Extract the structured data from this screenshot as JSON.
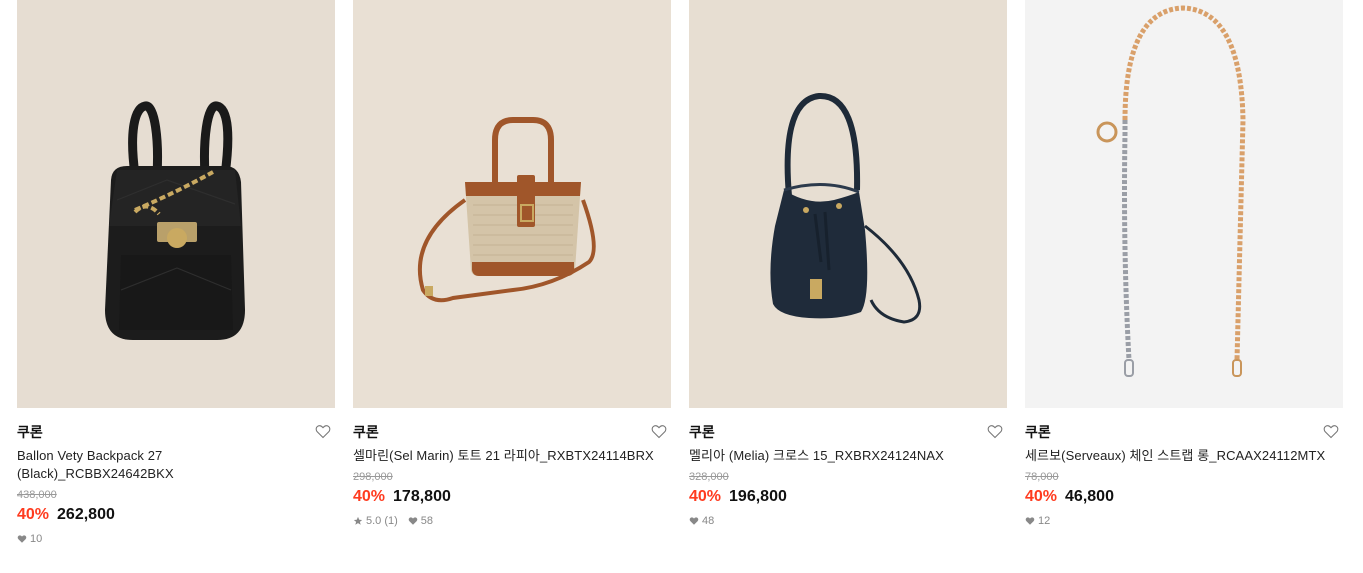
{
  "products": [
    {
      "brand": "쿠론",
      "name": "Ballon Vety Backpack 27 (Black)_RCBBX24642BKX",
      "original_price": "438,000",
      "discount": "40%",
      "price": "262,800",
      "rating": "",
      "likes": "10",
      "image": "black-leather-backpack",
      "bg": "#e6ddd2"
    },
    {
      "brand": "쿠론",
      "name": "셀마린(Sel Marin) 토트 21 라피아_RXBTX24114BRX",
      "original_price": "298,000",
      "discount": "40%",
      "price": "178,800",
      "rating": "5.0 (1)",
      "likes": "58",
      "image": "raffia-tote-bag",
      "bg": "#e9e0d4"
    },
    {
      "brand": "쿠론",
      "name": "멜리아 (Melia) 크로스 15_RXBRX24124NAX",
      "original_price": "328,000",
      "discount": "40%",
      "price": "196,800",
      "rating": "",
      "likes": "48",
      "image": "navy-bucket-bag",
      "bg": "#e7ded2"
    },
    {
      "brand": "쿠론",
      "name": "세르보(Serveaux) 체인 스트랩 롱_RCAAX24112MTX",
      "original_price": "78,000",
      "discount": "40%",
      "price": "46,800",
      "rating": "",
      "likes": "12",
      "image": "chain-strap",
      "bg": "#f3f3f3"
    }
  ],
  "colors": {
    "discount": "#ff3b1f",
    "muted": "#999999"
  }
}
